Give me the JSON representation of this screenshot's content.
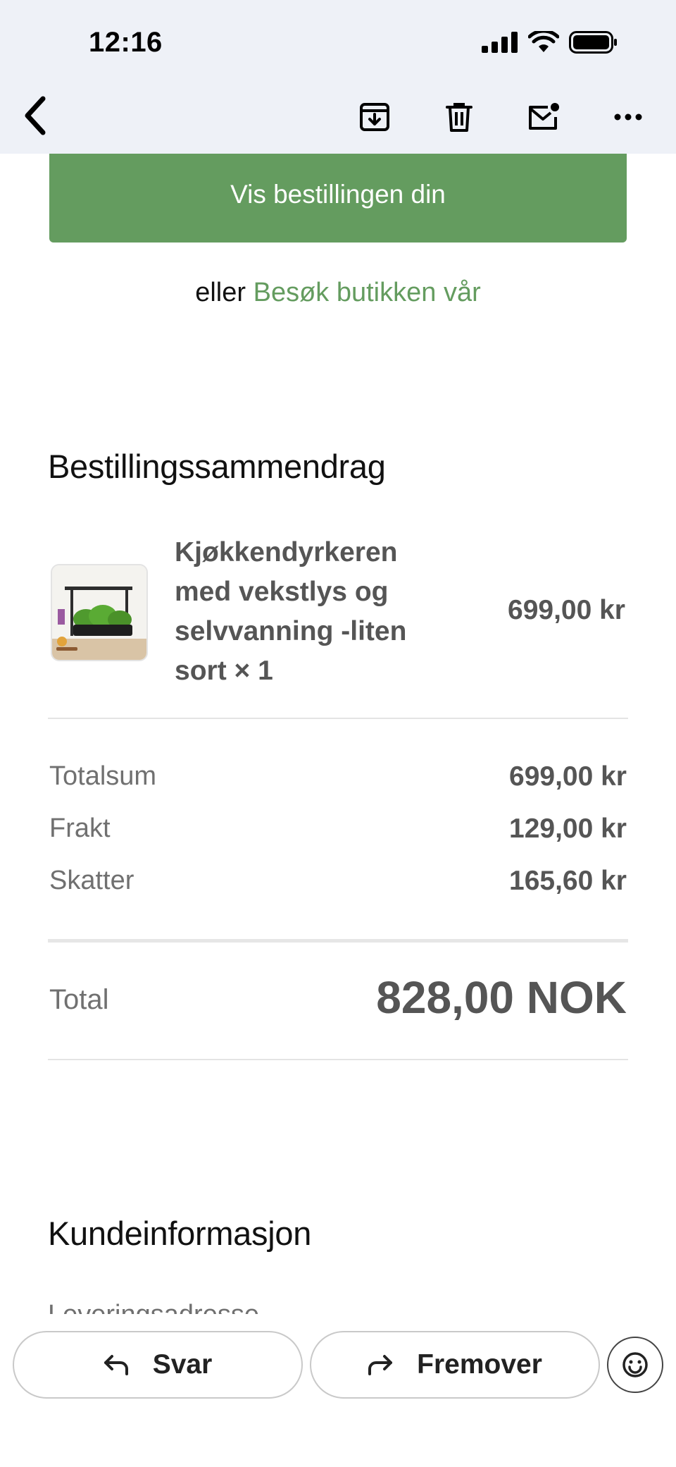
{
  "status_bar": {
    "time": "12:16",
    "icons": [
      "cellular-signal-icon",
      "wifi-icon",
      "battery-icon"
    ]
  },
  "nav": {
    "back_icon": "chevron-left-icon",
    "actions": [
      "archive-icon",
      "trash-icon",
      "mark-unread-icon",
      "more-icon"
    ]
  },
  "email": {
    "cta_label": "Vis bestillingen din",
    "or_text": "eller",
    "store_link": "Besøk butikken vår",
    "summary": {
      "title": "Bestillingssammendrag",
      "item": {
        "name_lines": [
          "Kjøkkendyrkeren",
          "med vekstlys og",
          "selvvanning -liten",
          "sort × 1"
        ],
        "price": "699,00 kr"
      },
      "rows": [
        {
          "label": "Totalsum",
          "value": "699,00 kr"
        },
        {
          "label": "Frakt",
          "value": "129,00 kr"
        },
        {
          "label": "Skatter",
          "value": "165,60 kr"
        }
      ],
      "total_label": "Total",
      "total_value": "828,00 NOK"
    },
    "customer": {
      "title": "Kundeinformasjon",
      "delivery_label": "Leveringsadresse"
    }
  },
  "bottom_bar": {
    "reply_label": "Svar",
    "forward_label": "Fremover",
    "emoji_icon": "smiley-icon"
  },
  "colors": {
    "accent_green": "#649c5f",
    "chrome_bg": "#eef1f7",
    "text_gray": "#555555"
  }
}
